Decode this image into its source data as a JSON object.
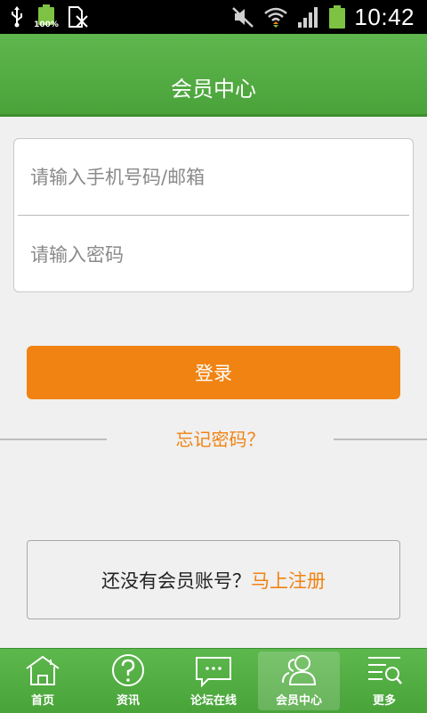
{
  "status_bar": {
    "battery_small_label": "100%",
    "time": "10:42",
    "icons": [
      "usb-icon",
      "battery-icon",
      "sim-icon",
      "mute-icon",
      "wifi-icon",
      "signal-icon",
      "battery-icon"
    ]
  },
  "header": {
    "title": "会员中心"
  },
  "login": {
    "account_placeholder": "请输入手机号码/邮箱",
    "account_value": "",
    "password_placeholder": "请输入密码",
    "password_value": "",
    "submit_label": "登录",
    "forgot_label": "忘记密码？"
  },
  "register": {
    "prompt": "还没有会员账号？",
    "link": "马上注册"
  },
  "bottom_nav": {
    "items": [
      {
        "label": "首页",
        "icon": "home-icon",
        "active": false
      },
      {
        "label": "资讯",
        "icon": "question-icon",
        "active": false
      },
      {
        "label": "论坛在线",
        "icon": "chat-icon",
        "active": false
      },
      {
        "label": "会员中心",
        "icon": "users-icon",
        "active": true
      },
      {
        "label": "更多",
        "icon": "more-search-icon",
        "active": false
      }
    ]
  },
  "colors": {
    "brand_green": "#4aa33a",
    "accent_orange": "#f08312",
    "background": "#f0f0f0"
  }
}
